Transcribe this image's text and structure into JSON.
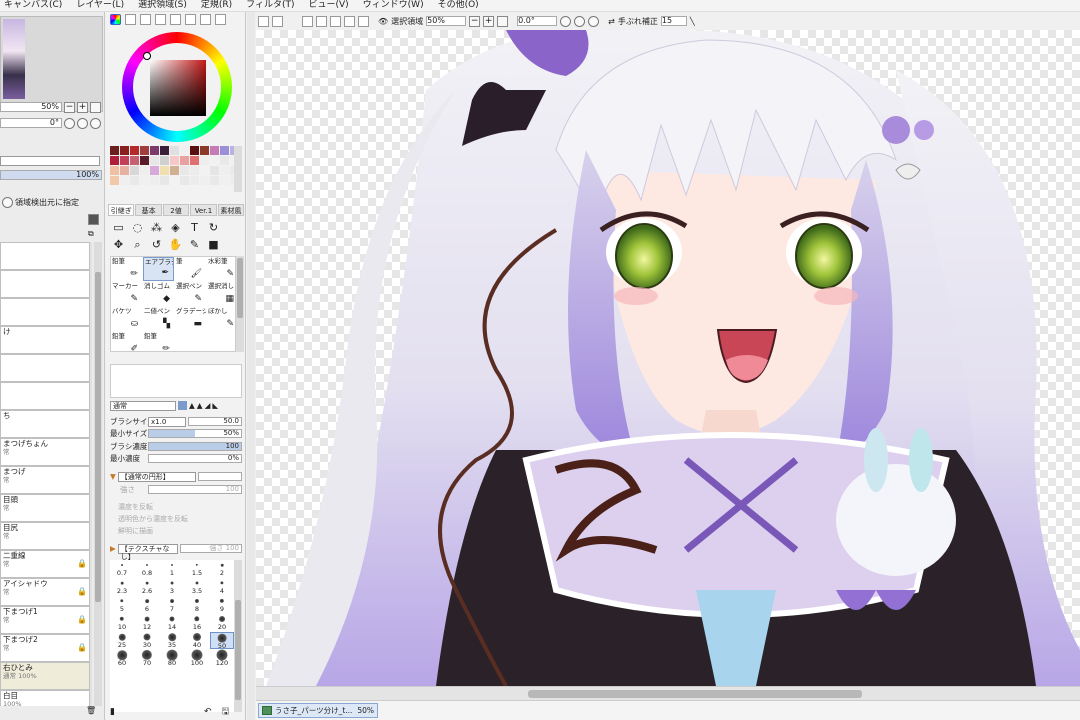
{
  "menu": [
    "キャンバス(C)",
    "レイヤー(L)",
    "選択領域(S)",
    "定規(R)",
    "フィルタ(T)",
    "ビュー(V)",
    "ウィンドウ(W)",
    "その他(O)"
  ],
  "navigator": {
    "zoom": "50%",
    "angle": "0°"
  },
  "layer_panel": {
    "opacity": "100%",
    "detect_source_label": "領域検出元に指定",
    "layers": [
      {
        "name": "",
        "sub": ""
      },
      {
        "name": "",
        "sub": ""
      },
      {
        "name": "",
        "sub": ""
      },
      {
        "name": "け",
        "sub": ""
      },
      {
        "name": "",
        "sub": ""
      },
      {
        "name": "",
        "sub": ""
      },
      {
        "name": "ち",
        "sub": ""
      },
      {
        "name": "まつげちょん",
        "sub": "常"
      },
      {
        "name": "まつげ",
        "sub": "常"
      },
      {
        "name": "目頭",
        "sub": "常"
      },
      {
        "name": "目尻",
        "sub": "常"
      },
      {
        "name": "二重線",
        "sub": "常"
      },
      {
        "name": "アイシャドウ",
        "sub": "常"
      },
      {
        "name": "下まつげ1",
        "sub": "常"
      },
      {
        "name": "下まつげ2",
        "sub": "常"
      },
      {
        "name": "右ひとみ",
        "sub": "通常 100%"
      },
      {
        "name": "白目",
        "sub": "100%"
      }
    ]
  },
  "tool_panel": {
    "tabs": [
      "引継ぎ",
      "基本",
      "2値",
      "Ver.1",
      "素材風"
    ],
    "brushes": [
      "鉛筆",
      "エアブラシ",
      "筆",
      "水彩筆",
      "マーカー",
      "消しゴム",
      "選択ペン",
      "選択消し",
      "バケツ",
      "二値ペン",
      "グラデーション",
      "ぼかし",
      "鉛筆",
      "鉛筆"
    ],
    "blend_mode": "通常",
    "brush_size": {
      "label": "ブラシサイズ",
      "mult": "x1.0",
      "value": "50.0"
    },
    "min_size": {
      "label": "最小サイズ",
      "value": "50%",
      "fill": 0.5
    },
    "brush_density": {
      "label": "ブラシ濃度",
      "value": "100",
      "fill": 1.0
    },
    "min_density": {
      "label": "最小濃度",
      "value": "0%",
      "fill": 0.0
    },
    "shape_select": "【通常の円形】",
    "shape_strength": "強さ",
    "shape_value": "100",
    "checks": [
      "濃度を反転",
      "透明色から濃度を反転",
      "鮮明に描画"
    ],
    "texture_select": "【テクスチャなし】",
    "texture_value": "100",
    "texture_prefix": "強さ",
    "sizes": [
      "0.7",
      "0.8",
      "1",
      "1.5",
      "2",
      "2.3",
      "2.6",
      "3",
      "3.5",
      "4",
      "5",
      "6",
      "7",
      "8",
      "9",
      "10",
      "12",
      "14",
      "16",
      "20",
      "25",
      "30",
      "35",
      "40",
      "50",
      "60",
      "70",
      "80",
      "100",
      "120"
    ],
    "selected_size": "50"
  },
  "toolbar": {
    "selection_label": "選択領域",
    "zoom": "50%",
    "angle": "0.0°",
    "stabilizer_label": "手ぶれ補正",
    "stabilizer_value": "15"
  },
  "document": {
    "name": "うさ子_パーツ分け_t...",
    "zoom": "50%"
  },
  "colors": {
    "swatches": [
      "#6b1f1f",
      "#8a1e1e",
      "#b42a2a",
      "#a03e3e",
      "#7a3a6a",
      "#3a1e3a",
      "#e0e0e0",
      "#f0f0f0",
      "#5a1010",
      "#8b3a2a",
      "#c57bb5",
      "#9b8fd8",
      "#b9b2e6",
      "#b01e3a",
      "#c0405a",
      "#c76070",
      "#5a1a2a",
      "#e7e7e7",
      "#d0d0d0",
      "#f7c8c8",
      "#e8a0a0",
      "#e07070",
      "#eeeeee",
      "#f1f1f1",
      "#e9e9e9",
      "#f0f0f0",
      "#f0c0a0",
      "#e8b0a0",
      "#d8d8d8",
      "#eeeeee",
      "#d8a8d8",
      "#f0e0b0",
      "#d0b090",
      "#e8e8e8",
      "#ececec",
      "#f2f2f2",
      "#e5e5e5",
      "#efefef",
      "#eaeaea",
      "#f1c8a8",
      "#efefef",
      "#e9e9e9",
      "#f0f0f0",
      "#eeeeee",
      "#e7e7e7",
      "#f2f2f2",
      "#e8e8e8",
      "#ececec",
      "#efefef",
      "#e9e9e9",
      "#f0f0f0",
      "#eeeeee"
    ]
  }
}
